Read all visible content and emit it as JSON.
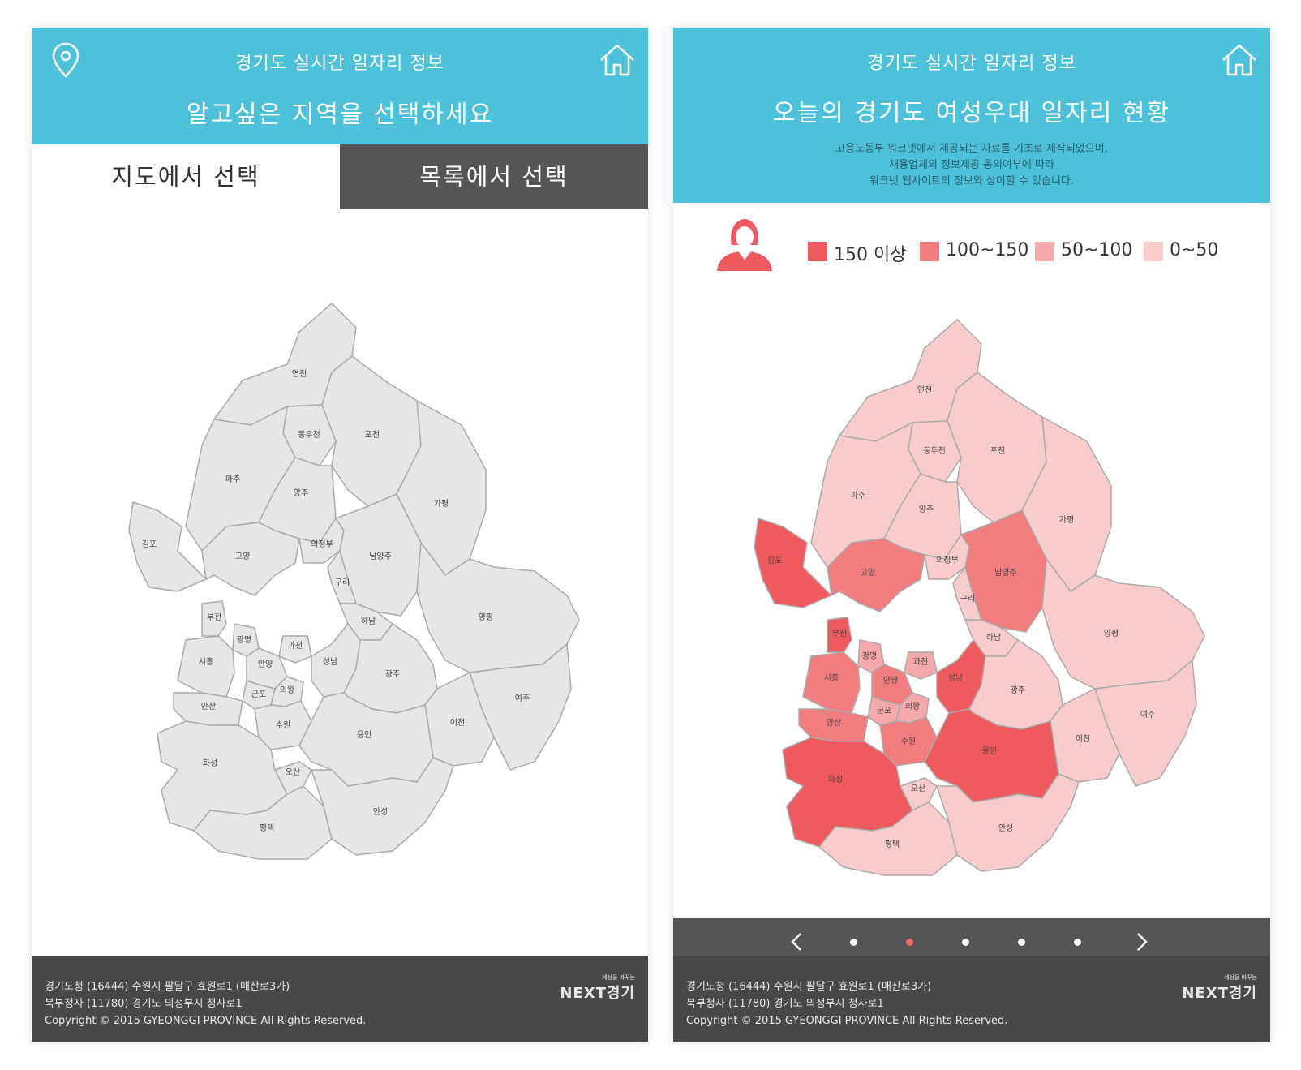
{
  "screen_left": {
    "header": {
      "app_title": "경기도 실시간 일자리 정보",
      "prompt": "알고싶은 지역을 선택하세요",
      "location_icon": "map-pin-icon",
      "home_icon": "home-icon"
    },
    "tabs": [
      {
        "label": "지도에서 선택",
        "active": true
      },
      {
        "label": "목록에서 선택",
        "active": false
      }
    ],
    "map_color": "#e6e6e6"
  },
  "screen_right": {
    "header": {
      "app_title": "경기도 실시간 일자리 정보",
      "title": "오늘의 경기도 여성우대 일자리 현황",
      "note_lines": [
        "고용노동부 워크넷에서 제공되는 자료를 기초로 제작되었으며,",
        "채용업체의 정보제공 동의여부에 따라",
        "워크넷 웹사이트의 정보와 상이할 수 있습니다."
      ],
      "home_icon": "home-icon"
    },
    "legend": {
      "icon": "woman-icon",
      "items": [
        {
          "label": "150 이상",
          "color": "#ef5a5e"
        },
        {
          "label": "100~150",
          "color": "#f27d7f"
        },
        {
          "label": "50~100",
          "color": "#f6a9aa"
        },
        {
          "label": "0~50",
          "color": "#f9cccc"
        }
      ]
    },
    "pager": {
      "dot_count": 5,
      "active_index": 1,
      "prev_icon": "chevron-left-icon",
      "next_icon": "chevron-right-icon"
    }
  },
  "regions": [
    {
      "name": "연천",
      "level": 3
    },
    {
      "name": "포천",
      "level": 3
    },
    {
      "name": "동두천",
      "level": 3
    },
    {
      "name": "파주",
      "level": 3
    },
    {
      "name": "양주",
      "level": 3
    },
    {
      "name": "가평",
      "level": 3
    },
    {
      "name": "김포",
      "level": 0
    },
    {
      "name": "고양",
      "level": 1
    },
    {
      "name": "의정부",
      "level": 3
    },
    {
      "name": "남양주",
      "level": 1
    },
    {
      "name": "구리",
      "level": 3
    },
    {
      "name": "하남",
      "level": 3
    },
    {
      "name": "양평",
      "level": 3
    },
    {
      "name": "부천",
      "level": 0
    },
    {
      "name": "광명",
      "level": 2
    },
    {
      "name": "과천",
      "level": 2
    },
    {
      "name": "시흥",
      "level": 1
    },
    {
      "name": "안양",
      "level": 1
    },
    {
      "name": "성남",
      "level": 0
    },
    {
      "name": "광주",
      "level": 3
    },
    {
      "name": "군포",
      "level": 2
    },
    {
      "name": "의왕",
      "level": 2
    },
    {
      "name": "안산",
      "level": 1
    },
    {
      "name": "여주",
      "level": 3
    },
    {
      "name": "수원",
      "level": 1
    },
    {
      "name": "이천",
      "level": 3
    },
    {
      "name": "화성",
      "level": 0
    },
    {
      "name": "용인",
      "level": 0
    },
    {
      "name": "오산",
      "level": 3
    },
    {
      "name": "평택",
      "level": 3
    },
    {
      "name": "안성",
      "level": 3
    }
  ],
  "footer": {
    "line1": "경기도청 (16444) 수원시 팔달구 효원로1 (매산로3가)",
    "line2": "북부청사 (11780) 경기도 의정부시 청사로1",
    "line3": "Copyright © 2015 GYEONGGI PROVINCE All Rights Reserved.",
    "logo": "NEXT경기",
    "logo_sub": "세상을 바꾸는"
  }
}
